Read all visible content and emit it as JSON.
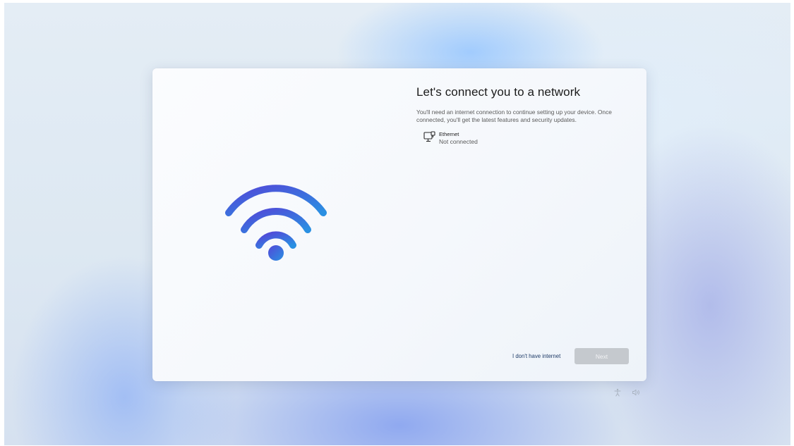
{
  "setup": {
    "title": "Let's connect you to a network",
    "description": "You'll need an internet connection to continue setting up your device. Once connected, you'll get the latest features and security updates.",
    "networks": [
      {
        "name": "Ethernet",
        "status": "Not connected",
        "icon": "ethernet-icon"
      }
    ],
    "no_internet_label": "I don't have internet",
    "next_label": "Next",
    "next_enabled": false
  },
  "hero": {
    "icon": "wifi-icon"
  },
  "tray": {
    "icons": [
      "accessibility-icon",
      "volume-icon"
    ]
  },
  "colors": {
    "wifi_gradient_start": "#4f4fd6",
    "wifi_gradient_end": "#2b8de0",
    "next_disabled_bg": "#c5c9ce",
    "link_text": "#1d3a66"
  }
}
